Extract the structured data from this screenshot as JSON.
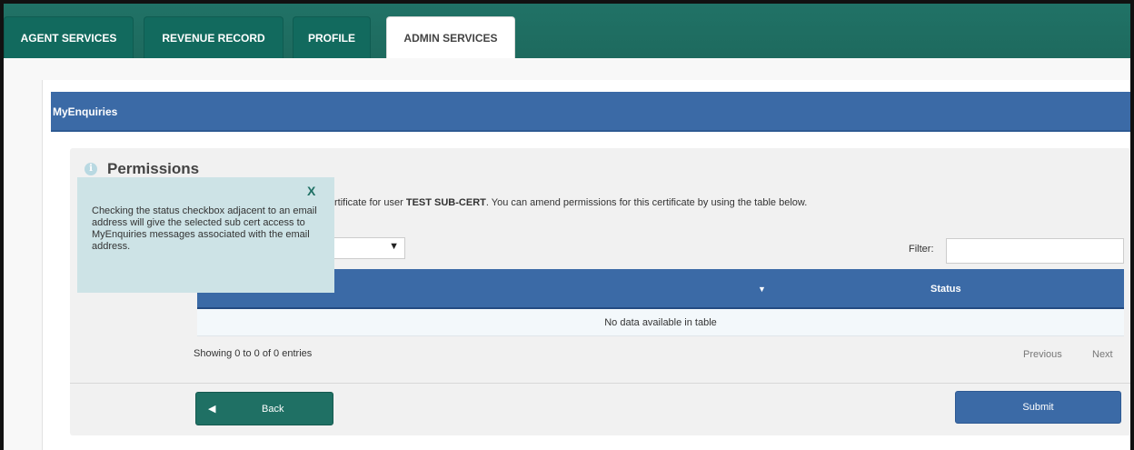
{
  "tabs": [
    {
      "label": "AGENT SERVICES",
      "active": false
    },
    {
      "label": "REVENUE RECORD",
      "active": false
    },
    {
      "label": "PROFILE",
      "active": false
    },
    {
      "label": "ADMIN SERVICES",
      "active": true
    }
  ],
  "panel": {
    "title": "MyEnquiries"
  },
  "permissions": {
    "title": "Permissions",
    "desc_prefix": "rtificate for user ",
    "desc_user": "TEST SUB-CERT",
    "desc_suffix": ". You can amend permissions for this certificate by using the table below."
  },
  "select": {
    "value": "",
    "arrow": "▼"
  },
  "filter": {
    "label": "Filter:",
    "value": ""
  },
  "table": {
    "columns": [
      "",
      "Status"
    ],
    "sort_arrow": "▼",
    "empty_message": "No data available in table"
  },
  "pagination": {
    "info": "Showing 0 to 0 of 0 entries",
    "previous": "Previous",
    "next": "Next"
  },
  "buttons": {
    "back": "Back",
    "submit": "Submit"
  },
  "tooltip": {
    "close": "X",
    "text": "Checking the status checkbox adjacent to an email address will give the selected sub cert access to MyEnquiries messages associated with the email address."
  },
  "colors": {
    "tabbar": "#207266",
    "header_blue": "#3b6aa6",
    "back_button": "#1f7064",
    "tooltip_bg": "#cde3e6"
  }
}
